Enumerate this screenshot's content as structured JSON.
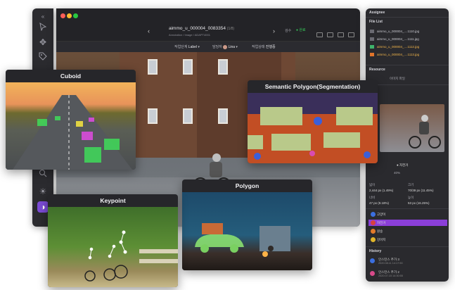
{
  "window": {
    "filename": "aimmo_u_000004_0083354",
    "frame_count": "(1/8)",
    "subtitle": "Annotation / Image / ADAPT4001",
    "status_label": "검수",
    "status_value": "완료",
    "sections": [
      {
        "label": "작업단계",
        "value": "Label"
      },
      {
        "label": "담당자",
        "value": "Lina"
      },
      {
        "label": "작업상태",
        "value": "진행중"
      }
    ]
  },
  "right_panel": {
    "assignee_title": "Assignee",
    "filelist_title": "File List",
    "files": [
      {
        "name": "aimmo_u_000004_....1110.jpg",
        "selected": false
      },
      {
        "name": "aimmo_u_000004_....1111.jpg",
        "selected": false
      },
      {
        "name": "aimmo_u_000004_....1112.jpg",
        "selected": true
      },
      {
        "name": "aimmo_u_000004_....1113.jpg",
        "selected": false
      }
    ],
    "resource_title": "Resource",
    "resource_row": "이미지 파일",
    "selected_class": "자전거",
    "percent": "40%",
    "stats": {
      "a_label": "넓이",
      "a_value": "2,444 px (1.49%)",
      "b_label": "크기",
      "b_value": "70/39 px (11.45%)",
      "c_label": "너비",
      "c_value": "47 px (9.18%)",
      "d_label": "높이",
      "d_value": "53 px (16.25%)"
    },
    "classes": [
      {
        "name": "고양이",
        "color": "#3b6fe0",
        "selected": false
      },
      {
        "name": "자전거",
        "color": "#d84040",
        "selected": true
      },
      {
        "name": "원숭",
        "color": "#e27a2a",
        "selected": false
      },
      {
        "name": "강아지",
        "color": "#e0b52a",
        "selected": false
      }
    ],
    "history_title": "History",
    "history": [
      {
        "label": "인스턴스 추가 3",
        "date": "2020.08.11 14:17:50",
        "color": "#3b6fe0"
      },
      {
        "label": "인스턴스 추가 2",
        "date": "2020.07.15 14:30:55",
        "color": "#d84a8a"
      }
    ]
  },
  "cards": {
    "cuboid": "Cuboid",
    "semantic": "Semantic Polygon(Segmentation)",
    "polygon": "Polygon",
    "keypoint": "Keypoint"
  },
  "icons": [
    "cursor-icon",
    "move-icon",
    "tag-icon",
    "zoom-icon",
    "brightness-icon",
    "contrast-icon"
  ]
}
